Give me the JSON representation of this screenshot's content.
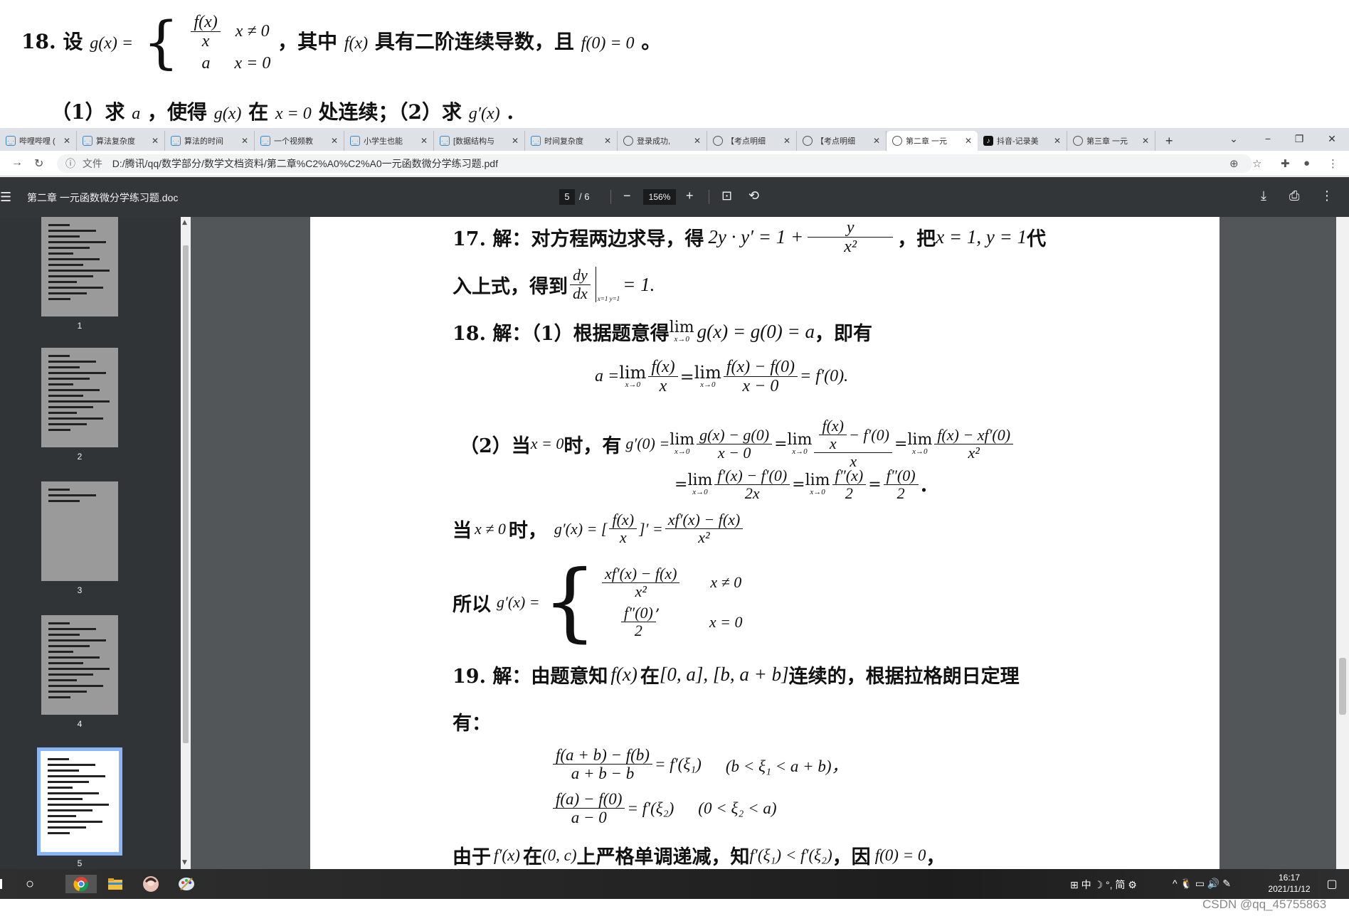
{
  "problem": {
    "q18_prefix": "18. 设",
    "q18_def": "g(x) =",
    "case1_num": "f(x)",
    "case1_den": "x",
    "case1_cond": "x ≠ 0",
    "case2_val": "a",
    "case2_cond": "x = 0",
    "q18_suffix_a": "，其中",
    "q18_f": "f(x)",
    "q18_suffix_b": "具有二阶连续导数，且",
    "q18_cond": "f(0) = 0",
    "q18_end": "。",
    "part_line_a": "（1）求",
    "part_a": "a",
    "part_line_b": "，使得",
    "part_g": "g(x)",
    "part_line_c": "在",
    "part_x0": "x = 0",
    "part_line_d": "处连续；（2）求",
    "part_gp": "g′(x)",
    "part_line_e": "."
  },
  "tabs": [
    {
      "label": "哔哩哔哩 (",
      "icon": "bilibili-icon"
    },
    {
      "label": "算法复杂度",
      "icon": "bilibili-icon"
    },
    {
      "label": "算法的时间",
      "icon": "bilibili-icon"
    },
    {
      "label": "一个视频教",
      "icon": "bilibili-icon"
    },
    {
      "label": "小学生也能",
      "icon": "bilibili-icon"
    },
    {
      "label": "[数据结构与",
      "icon": "bilibili-icon"
    },
    {
      "label": "时间复杂度",
      "icon": "bilibili-icon"
    },
    {
      "label": "登录成功,",
      "icon": "globe-icon"
    },
    {
      "label": "【考点明细",
      "icon": "globe-icon"
    },
    {
      "label": "【考点明细",
      "icon": "globe-icon"
    },
    {
      "label": "第二章 一元",
      "icon": "globe-icon"
    },
    {
      "label": "抖音-记录美",
      "icon": "tiktok-icon"
    },
    {
      "label": "第三章 一元",
      "icon": "globe-icon"
    }
  ],
  "address": {
    "file_label": "文件",
    "url": "D:/腾讯/qq/数学部分/数学文档资料/第二章%C2%A0%C2%A0一元函数微分学练习题.pdf"
  },
  "pdf": {
    "title": "第二章 一元函数微分学练习题.doc",
    "page": "5",
    "total": "/ 6",
    "zoom": "156%"
  },
  "thumbs": [
    "1",
    "2",
    "3",
    "4",
    "5"
  ],
  "content": {
    "s17_a": "17. 解：对方程两边求导，得",
    "s17_eq": "2y · y′ = 1 +",
    "s17_frac_num": "y",
    "s17_frac_den": "x²",
    "s17_b": "，把",
    "s17_sub": "x = 1, y = 1",
    "s17_c": "代",
    "s17_line2_a": "入上式，得到",
    "s17_dy": "dy",
    "s17_dx": "dx",
    "s17_at": "x=1 y=1",
    "s17_res": "= 1.",
    "s18_a": "18. 解：（1）根据题意得",
    "s18_lim": "lim",
    "s18_limsub": "x→0",
    "s18_eq1": "g(x) = g(0) = a",
    "s18_b": "，即有",
    "s18_eq2_a": "a =",
    "s18_fx": "f(x)",
    "s18_x": "x",
    "s18_eq2_num": "f(x) − f(0)",
    "s18_eq2_den": "x − 0",
    "s18_eq2_res": "= f′(0).",
    "s18_p2_a": "（2）当",
    "s18_p2_x0": "x = 0",
    "s18_p2_b": "时，有",
    "s18_p2_g": "g′(0) =",
    "s18_p2_num1": "g(x) − g(0)",
    "s18_p2_den1": "x − 0",
    "s18_p2_inner": "− f′(0)",
    "s18_p2_num3": "f(x) − xf′(0)",
    "s18_p2_den3": "x²",
    "s18_p3_num1": "f′(x) − f′(0)",
    "s18_p3_den1": "2x",
    "s18_p3_num2": "f″(x)",
    "s18_p3_num3": "f″(0)",
    "s18_p3_den": "2",
    "s18_p3_end": ".",
    "s18_p4_a": "当",
    "s18_p4_cond": "x ≠ 0",
    "s18_p4_b": "时，",
    "s18_p4_g": "g′(x) = [",
    "s18_p4_mid": "]′ =",
    "s18_p4_num": "xf′(x) − f(x)",
    "s18_p4_den": "x²",
    "s18_p5_a": "所以",
    "s18_p5_g": "g′(x) =",
    "s18_p5_c1_num": "xf′(x) − f(x)",
    "s18_p5_c1_den": "x²",
    "s18_p5_c1_cond": "x ≠ 0",
    "s18_p5_c2_num": "f″(0)",
    "s18_p5_c2_den": "2",
    "s18_p5_c2_cond": "x = 0",
    "s18_p5_comma": ",",
    "s19_a": "19. 解：由题意知",
    "s19_f": "f(x)",
    "s19_b": "在",
    "s19_int": "[0, a], [b, a + b]",
    "s19_c": "连续的，根据拉格朗日定理",
    "s19_line2": "有：",
    "s19_e1_num": "f(a + b) − f(b)",
    "s19_e1_den": "a + b − b",
    "s19_e1_res": "= f′(ξ₁)",
    "s19_e1_cond": "(b < ξ₁ < a + b)，",
    "s19_e2_num": "f(a) − f(0)",
    "s19_e2_den": "a − 0",
    "s19_e2_res": "= f′(ξ₂)",
    "s19_e2_cond": "(0 < ξ₂ < a)",
    "s19_last_a": "由于",
    "s19_last_f": "f′(x)",
    "s19_last_b": "在",
    "s19_last_int": "(0, c)",
    "s19_last_c": "上严格单调递减，知",
    "s19_last_ineq": "f′(ξ₁) < f′(ξ₂)",
    "s19_last_d": "，因",
    "s19_last_f0": "f(0) = 0",
    "s19_last_e": "，"
  },
  "taskbar": {
    "tray_ime": "中",
    "tray_mode": "简",
    "time": "16:17",
    "date": "2021/11/12"
  },
  "watermark": "CSDN @qq_45755863"
}
